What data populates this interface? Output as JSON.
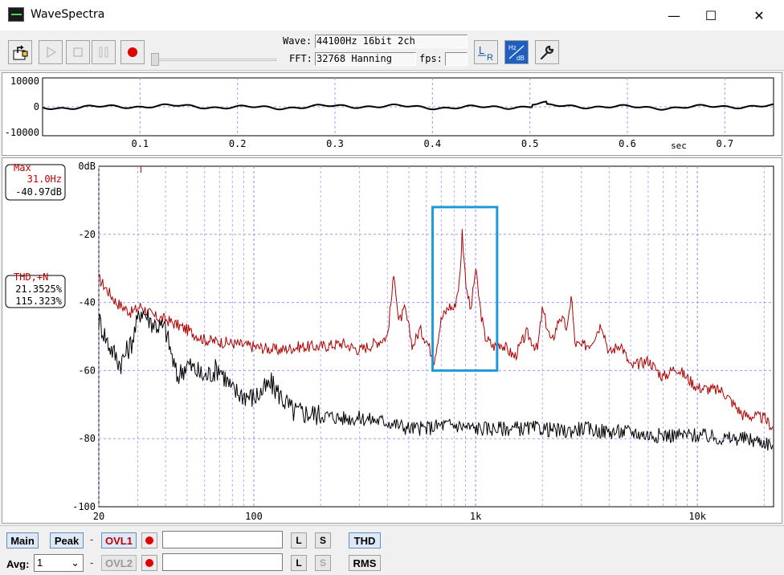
{
  "window": {
    "title": "WaveSpectra",
    "minimize": "—",
    "maximize": "☐",
    "close": "✕"
  },
  "toolbar": {
    "wave_label": "Wave:",
    "wave_value": "44100Hz 16bit 2ch",
    "fft_label": "FFT:",
    "fft_value": "32768 Hanning",
    "fps_label": "fps:",
    "fps_value": "",
    "lr_icon": "L R",
    "hz_db_icon": "Hz dB",
    "icons": [
      "open-file-icon",
      "play-icon",
      "stop-icon",
      "pause-icon",
      "record-icon",
      "lr-channel-icon",
      "hz-db-scale-icon",
      "settings-wrench-icon"
    ]
  },
  "waveform": {
    "y_ticks": [
      "10000",
      "0",
      "-10000"
    ],
    "x_ticks": [
      "0.1",
      "0.2",
      "0.3",
      "0.4",
      "0.5",
      "0.6",
      "0.7"
    ],
    "x_unit": "sec"
  },
  "spectrum": {
    "max_box": {
      "title": "Max",
      "freq": "31.0Hz",
      "level": "-40.97dB"
    },
    "thd_box": {
      "title": "THD,+N",
      "val1": "21.3525%",
      "val2": "115.323%"
    },
    "y_ticks": [
      "0dB",
      "-20",
      "-40",
      "-60",
      "-80",
      "-100"
    ],
    "x_ticks": [
      "20",
      "100",
      "1k",
      "10k"
    ]
  },
  "chart_data": {
    "type": "line",
    "x_scale": "log",
    "xlim": [
      20,
      22050
    ],
    "ylim": [
      -100,
      0
    ],
    "ylabel_ticks": [
      "0dB",
      "-20",
      "-40",
      "-60",
      "-80",
      "-100"
    ],
    "xlabel_ticks": [
      "20",
      "100",
      "1k",
      "10k"
    ],
    "series": [
      {
        "color": "#b00000",
        "x": [
          20,
          24,
          28,
          31,
          35,
          40,
          50,
          60,
          80,
          100,
          130,
          160,
          200,
          250,
          300,
          350,
          400,
          430,
          450,
          480,
          520,
          560,
          600,
          650,
          700,
          760,
          800,
          850,
          870,
          900,
          950,
          1000,
          1050,
          1100,
          1200,
          1300,
          1500,
          1700,
          1900,
          2000,
          2200,
          2400,
          2600,
          2700,
          2800,
          3000,
          3300,
          3700,
          4000,
          4500,
          5000,
          6000,
          7000,
          8000,
          10000,
          13000,
          16000,
          20000,
          22050
        ],
        "values": [
          -33,
          -40,
          -43,
          -41,
          -44,
          -45,
          -48,
          -51,
          -52,
          -53,
          -54,
          -53,
          -53,
          -52,
          -54,
          -52,
          -50,
          -31,
          -46,
          -42,
          -53,
          -48,
          -51,
          -57,
          -45,
          -41,
          -42,
          -33,
          -19,
          -33,
          -43,
          -30,
          -42,
          -50,
          -53,
          -52,
          -56,
          -49,
          -54,
          -42,
          -52,
          -44,
          -48,
          -37,
          -52,
          -53,
          -52,
          -46,
          -55,
          -52,
          -59,
          -57,
          -62,
          -59,
          -65,
          -66,
          -73,
          -74,
          -77
        ]
      },
      {
        "color": "#000000",
        "x": [
          20,
          22,
          25,
          28,
          31,
          35,
          40,
          45,
          50,
          60,
          70,
          80,
          100,
          120,
          150,
          200,
          250,
          300,
          400,
          500,
          600,
          700,
          800,
          1000,
          1200,
          1500,
          2000,
          2500,
          3000,
          4000,
          5000,
          6000,
          8000,
          10000,
          13000,
          16000,
          20000,
          22050
        ],
        "values": [
          -45,
          -52,
          -58,
          -52,
          -42,
          -46,
          -48,
          -62,
          -58,
          -62,
          -59,
          -66,
          -68,
          -64,
          -72,
          -73,
          -74,
          -74,
          -75,
          -77,
          -77,
          -76,
          -76,
          -77,
          -77,
          -77,
          -77,
          -78,
          -77,
          -78,
          -78,
          -79,
          -79,
          -79,
          -80,
          -80,
          -81,
          -82
        ]
      }
    ]
  }
}
